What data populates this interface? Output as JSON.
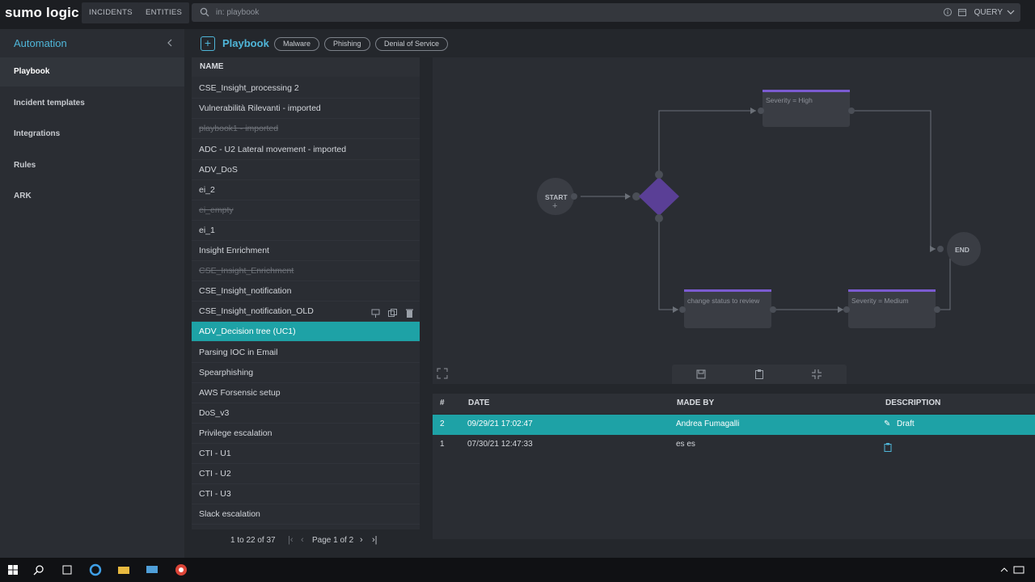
{
  "app": {
    "logo": "sumo logic",
    "nav": [
      "INCIDENTS",
      "ENTITIES"
    ],
    "search": {
      "value": "in: playbook",
      "query_label": "QUERY"
    }
  },
  "sidebar": {
    "title": "Automation",
    "items": [
      {
        "label": "Playbook"
      },
      {
        "label": "Incident templates"
      },
      {
        "label": "Integrations"
      },
      {
        "label": "Rules"
      },
      {
        "label": "ARK"
      }
    ]
  },
  "header": {
    "title": "Playbook",
    "tags": [
      "Malware",
      "Phishing",
      "Denial of Service"
    ]
  },
  "list": {
    "column": "NAME",
    "rows": [
      {
        "name": "CSE_Insight_processing 2"
      },
      {
        "name": "Vulnerabilità Rilevanti - imported"
      },
      {
        "name": "playbook1 - imported"
      },
      {
        "name": "ADC - U2 Lateral movement - imported"
      },
      {
        "name": "ADV_DoS"
      },
      {
        "name": "ei_2"
      },
      {
        "name": "ei_empty"
      },
      {
        "name": "ei_1"
      },
      {
        "name": "Insight Enrichment"
      },
      {
        "name": "CSE_Insight_Enrichment"
      },
      {
        "name": "CSE_Insight_notification"
      },
      {
        "name": "CSE_Insight_notification_OLD"
      },
      {
        "name": "ADV_Decision tree (UC1)"
      },
      {
        "name": "Parsing IOC in Email"
      },
      {
        "name": "Spearphishing"
      },
      {
        "name": "AWS Forsensic setup"
      },
      {
        "name": "DoS_v3"
      },
      {
        "name": "Privilege escalation"
      },
      {
        "name": "CTI - U1"
      },
      {
        "name": "CTI - U2"
      },
      {
        "name": "CTI - U3"
      },
      {
        "name": "Slack escalation"
      }
    ],
    "pager": {
      "count": "1 to 22 of 37",
      "page": "Page 1 of 2"
    }
  },
  "canvas": {
    "start_label": "START",
    "end_label": "END",
    "nodes": [
      "Severity = High",
      "change status to review",
      "Severity = Medium"
    ],
    "accent": "#7b5bd1"
  },
  "versions": {
    "columns": [
      "#",
      "DATE",
      "MADE BY",
      "DESCRIPTION"
    ],
    "rows": [
      {
        "num": "2",
        "date": "09/29/21 17:02:47",
        "by": "Andrea Fumagalli",
        "desc": "Draft"
      },
      {
        "num": "1",
        "date": "07/30/21 12:47:33",
        "by": "es es",
        "desc": ""
      }
    ]
  },
  "colors": {
    "accent_teal": "#1ea2a6",
    "link_blue": "#4fb6d9"
  }
}
